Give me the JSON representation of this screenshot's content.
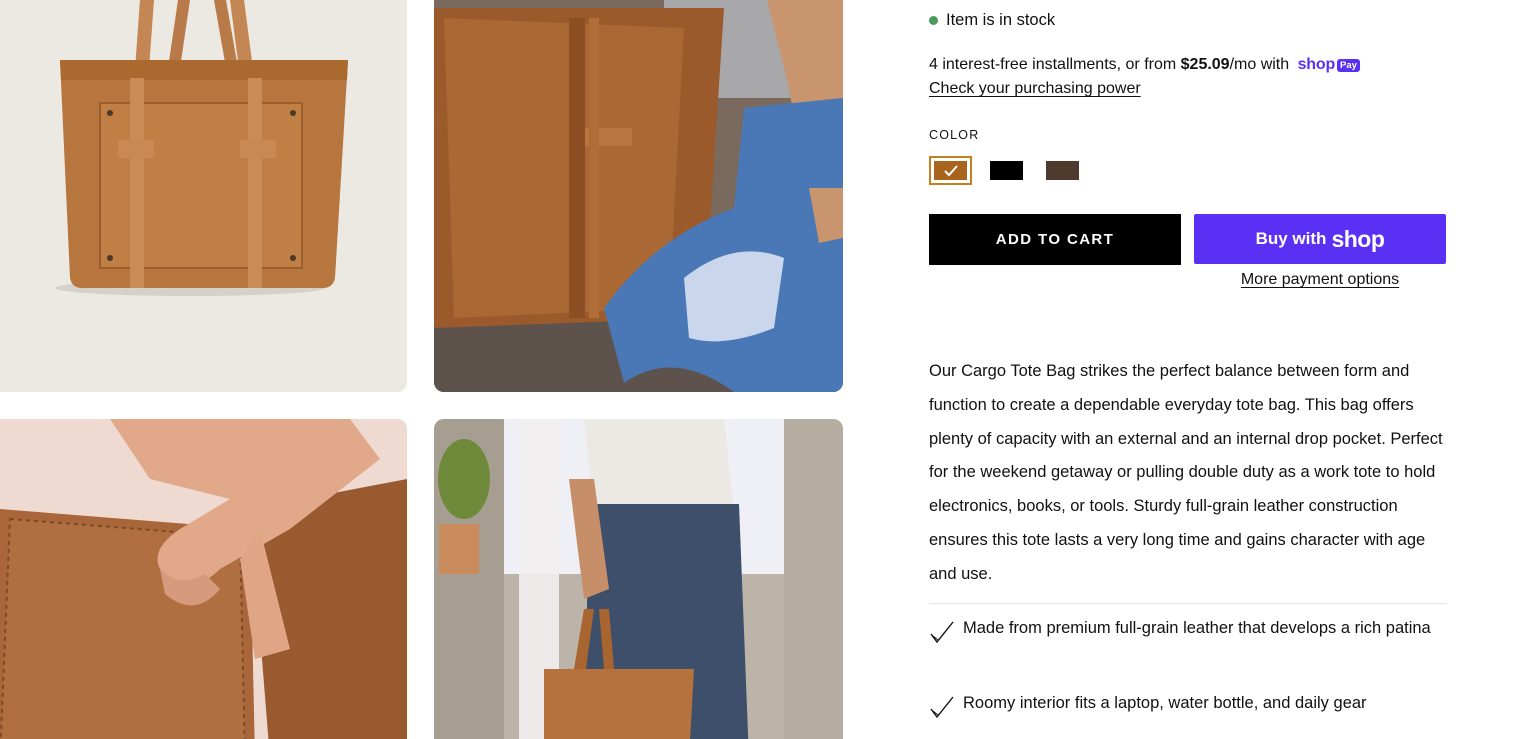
{
  "product": {
    "stock_status": "Item is in stock",
    "stock_color": "#4a9a5c",
    "installments": {
      "prefix": "4 interest-free installments, or from ",
      "amount": "$25.09",
      "suffix": "/mo with ",
      "brand": "shop",
      "brand_badge": "Pay",
      "link": "Check your purchasing power"
    },
    "color_label": "COLOR",
    "swatches": [
      {
        "name": "Brown",
        "color": "#a8641c",
        "selected": true
      },
      {
        "name": "Black",
        "color": "#000000",
        "selected": false
      },
      {
        "name": "Dark Brown",
        "color": "#4e3b2d",
        "selected": false
      }
    ],
    "add_to_cart": "ADD TO CART",
    "buy_with": "Buy with",
    "buy_brand": "shop",
    "more_payment": "More payment options",
    "description": "Our Cargo Tote Bag strikes the perfect balance between form and function to create a dependable everyday tote bag. This bag offers plenty of capacity with an external and an internal drop pocket. Perfect for the weekend getaway or pulling double duty as a work tote to hold electronics, books, or tools. Sturdy full-grain leather construction ensures this tote lasts a very long time and gains character with age and use.",
    "features": [
      {
        "text": "Made from premium full-grain leather that develops a rich patina",
        "icon": "checkmark-icon"
      },
      {
        "text": "Roomy interior fits a laptop, water bottle, and daily gear",
        "icon": "checkmark-icon"
      }
    ]
  },
  "colors": {
    "accent_purple": "#5a31f4",
    "selected_outline": "#c47f1f"
  },
  "gallery": [
    {
      "alt": "tan-leather-tote-product-photo"
    },
    {
      "alt": "tote-held-by-seated-model"
    },
    {
      "alt": "leather-passport-cover-in-hand"
    },
    {
      "alt": "man-carrying-tote-by-window"
    }
  ]
}
